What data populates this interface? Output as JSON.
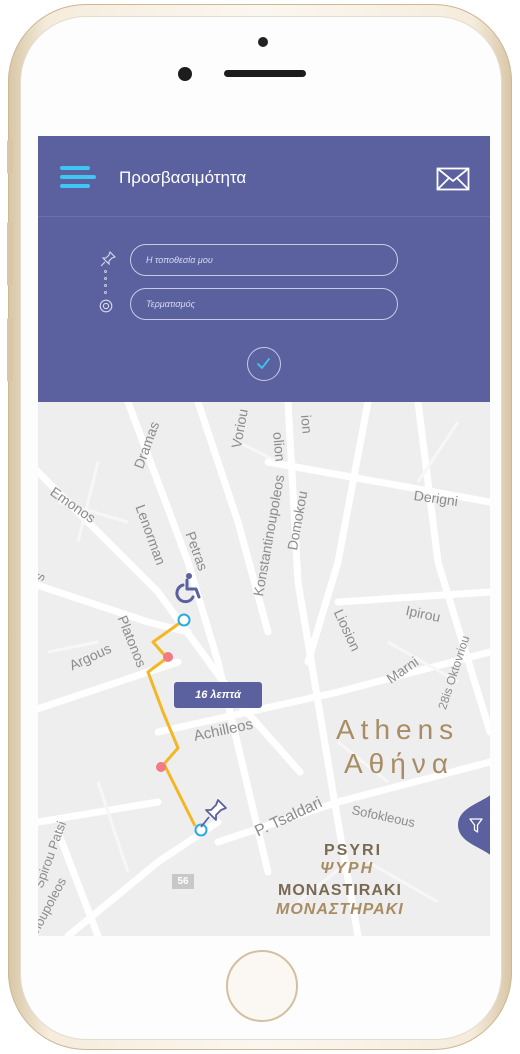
{
  "app": {
    "title": "Προσβασιμότητα"
  },
  "icons": {
    "menu": "hamburger-menu-icon",
    "mail": "envelope-icon",
    "origin": "pushpin-icon",
    "destination": "target-icon",
    "confirm": "checkmark-icon",
    "filter": "funnel-icon",
    "accessibility": "wheelchair-icon"
  },
  "search": {
    "origin_placeholder": "Η τοποθεσία μου",
    "destination_placeholder": "Τερματισμός"
  },
  "map": {
    "route_duration": "16 λεπτά",
    "road_badge": "56",
    "streets": [
      "Dramas",
      "Voriou",
      "olion",
      "ion",
      "Konstantinoupoleos",
      "Domokou",
      "Derigni",
      "Emonos",
      "Lenorman",
      "Petras",
      "Liosion",
      "Ipirou",
      "28is Oktovriou",
      "Platonos",
      "Argous",
      "Marni",
      "Achilleos",
      "P. Tsaldari",
      "Sofokleous",
      "Spirou Patsi",
      "ntinoupoleos",
      "s"
    ],
    "city_en": "Athens",
    "city_gr": "Αθήνα",
    "district_1_en": "PSYRI",
    "district_1_gr": "ΨΥΡΗ",
    "district_2_en": "MONASTIRAKI",
    "district_2_gr": "ΜΟΝΑΣΤΗΡΑΚΙ"
  },
  "colors": {
    "header": "#5a619e",
    "menu_accent": "#3fc6f5",
    "route": "#f2b824",
    "route_stop": "#f27a85",
    "endpoint": "#29abe2",
    "label_gold": "#a88d64"
  }
}
